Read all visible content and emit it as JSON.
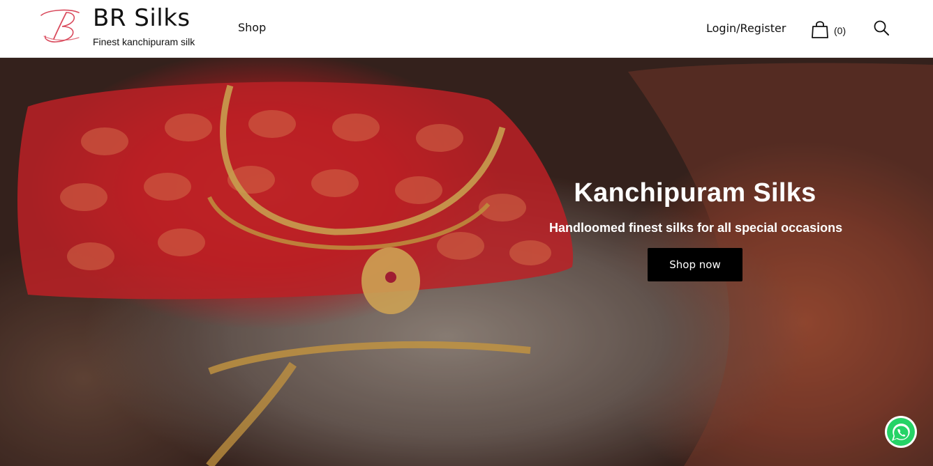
{
  "header": {
    "brand_name": "BR Silks",
    "tagline": "Finest kanchipuram silk",
    "nav": {
      "shop_label": "Shop",
      "login_label": "Login/Register"
    },
    "cart": {
      "count_label": "(0)",
      "icon": "shopping-bag-icon"
    },
    "search": {
      "icon": "search-icon"
    },
    "logo": {
      "icon": "script-b-logo",
      "accent_color": "#d94a5c"
    }
  },
  "hero": {
    "title": "Kanchipuram Silks",
    "subtitle": "Handloomed finest silks for all special occasions",
    "cta_label": "Shop now",
    "colors": {
      "text": "#ffffff",
      "cta_background": "#000000"
    }
  },
  "floating": {
    "whatsapp_icon": "whatsapp-icon",
    "color": "#25d366"
  }
}
